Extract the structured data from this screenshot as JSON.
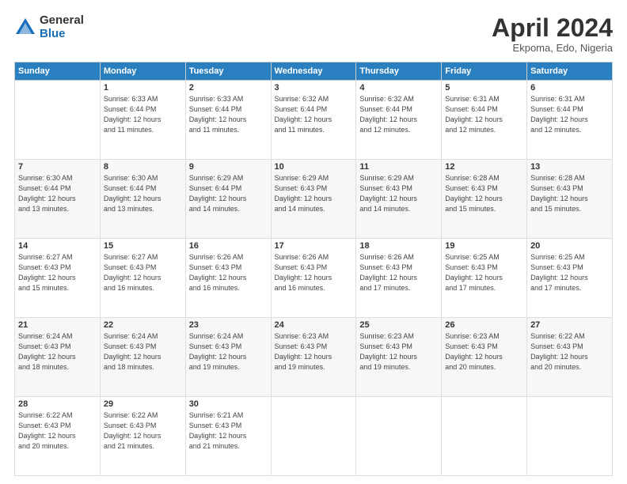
{
  "header": {
    "logo_general": "General",
    "logo_blue": "Blue",
    "month_title": "April 2024",
    "subtitle": "Ekpoma, Edo, Nigeria"
  },
  "columns": [
    "Sunday",
    "Monday",
    "Tuesday",
    "Wednesday",
    "Thursday",
    "Friday",
    "Saturday"
  ],
  "weeks": [
    [
      {
        "day": "",
        "info": ""
      },
      {
        "day": "1",
        "info": "Sunrise: 6:33 AM\nSunset: 6:44 PM\nDaylight: 12 hours\nand 11 minutes."
      },
      {
        "day": "2",
        "info": "Sunrise: 6:33 AM\nSunset: 6:44 PM\nDaylight: 12 hours\nand 11 minutes."
      },
      {
        "day": "3",
        "info": "Sunrise: 6:32 AM\nSunset: 6:44 PM\nDaylight: 12 hours\nand 11 minutes."
      },
      {
        "day": "4",
        "info": "Sunrise: 6:32 AM\nSunset: 6:44 PM\nDaylight: 12 hours\nand 12 minutes."
      },
      {
        "day": "5",
        "info": "Sunrise: 6:31 AM\nSunset: 6:44 PM\nDaylight: 12 hours\nand 12 minutes."
      },
      {
        "day": "6",
        "info": "Sunrise: 6:31 AM\nSunset: 6:44 PM\nDaylight: 12 hours\nand 12 minutes."
      }
    ],
    [
      {
        "day": "7",
        "info": "Sunrise: 6:30 AM\nSunset: 6:44 PM\nDaylight: 12 hours\nand 13 minutes."
      },
      {
        "day": "8",
        "info": "Sunrise: 6:30 AM\nSunset: 6:44 PM\nDaylight: 12 hours\nand 13 minutes."
      },
      {
        "day": "9",
        "info": "Sunrise: 6:29 AM\nSunset: 6:44 PM\nDaylight: 12 hours\nand 14 minutes."
      },
      {
        "day": "10",
        "info": "Sunrise: 6:29 AM\nSunset: 6:43 PM\nDaylight: 12 hours\nand 14 minutes."
      },
      {
        "day": "11",
        "info": "Sunrise: 6:29 AM\nSunset: 6:43 PM\nDaylight: 12 hours\nand 14 minutes."
      },
      {
        "day": "12",
        "info": "Sunrise: 6:28 AM\nSunset: 6:43 PM\nDaylight: 12 hours\nand 15 minutes."
      },
      {
        "day": "13",
        "info": "Sunrise: 6:28 AM\nSunset: 6:43 PM\nDaylight: 12 hours\nand 15 minutes."
      }
    ],
    [
      {
        "day": "14",
        "info": "Sunrise: 6:27 AM\nSunset: 6:43 PM\nDaylight: 12 hours\nand 15 minutes."
      },
      {
        "day": "15",
        "info": "Sunrise: 6:27 AM\nSunset: 6:43 PM\nDaylight: 12 hours\nand 16 minutes."
      },
      {
        "day": "16",
        "info": "Sunrise: 6:26 AM\nSunset: 6:43 PM\nDaylight: 12 hours\nand 16 minutes."
      },
      {
        "day": "17",
        "info": "Sunrise: 6:26 AM\nSunset: 6:43 PM\nDaylight: 12 hours\nand 16 minutes."
      },
      {
        "day": "18",
        "info": "Sunrise: 6:26 AM\nSunset: 6:43 PM\nDaylight: 12 hours\nand 17 minutes."
      },
      {
        "day": "19",
        "info": "Sunrise: 6:25 AM\nSunset: 6:43 PM\nDaylight: 12 hours\nand 17 minutes."
      },
      {
        "day": "20",
        "info": "Sunrise: 6:25 AM\nSunset: 6:43 PM\nDaylight: 12 hours\nand 17 minutes."
      }
    ],
    [
      {
        "day": "21",
        "info": "Sunrise: 6:24 AM\nSunset: 6:43 PM\nDaylight: 12 hours\nand 18 minutes."
      },
      {
        "day": "22",
        "info": "Sunrise: 6:24 AM\nSunset: 6:43 PM\nDaylight: 12 hours\nand 18 minutes."
      },
      {
        "day": "23",
        "info": "Sunrise: 6:24 AM\nSunset: 6:43 PM\nDaylight: 12 hours\nand 19 minutes."
      },
      {
        "day": "24",
        "info": "Sunrise: 6:23 AM\nSunset: 6:43 PM\nDaylight: 12 hours\nand 19 minutes."
      },
      {
        "day": "25",
        "info": "Sunrise: 6:23 AM\nSunset: 6:43 PM\nDaylight: 12 hours\nand 19 minutes."
      },
      {
        "day": "26",
        "info": "Sunrise: 6:23 AM\nSunset: 6:43 PM\nDaylight: 12 hours\nand 20 minutes."
      },
      {
        "day": "27",
        "info": "Sunrise: 6:22 AM\nSunset: 6:43 PM\nDaylight: 12 hours\nand 20 minutes."
      }
    ],
    [
      {
        "day": "28",
        "info": "Sunrise: 6:22 AM\nSunset: 6:43 PM\nDaylight: 12 hours\nand 20 minutes."
      },
      {
        "day": "29",
        "info": "Sunrise: 6:22 AM\nSunset: 6:43 PM\nDaylight: 12 hours\nand 21 minutes."
      },
      {
        "day": "30",
        "info": "Sunrise: 6:21 AM\nSunset: 6:43 PM\nDaylight: 12 hours\nand 21 minutes."
      },
      {
        "day": "",
        "info": ""
      },
      {
        "day": "",
        "info": ""
      },
      {
        "day": "",
        "info": ""
      },
      {
        "day": "",
        "info": ""
      }
    ]
  ]
}
